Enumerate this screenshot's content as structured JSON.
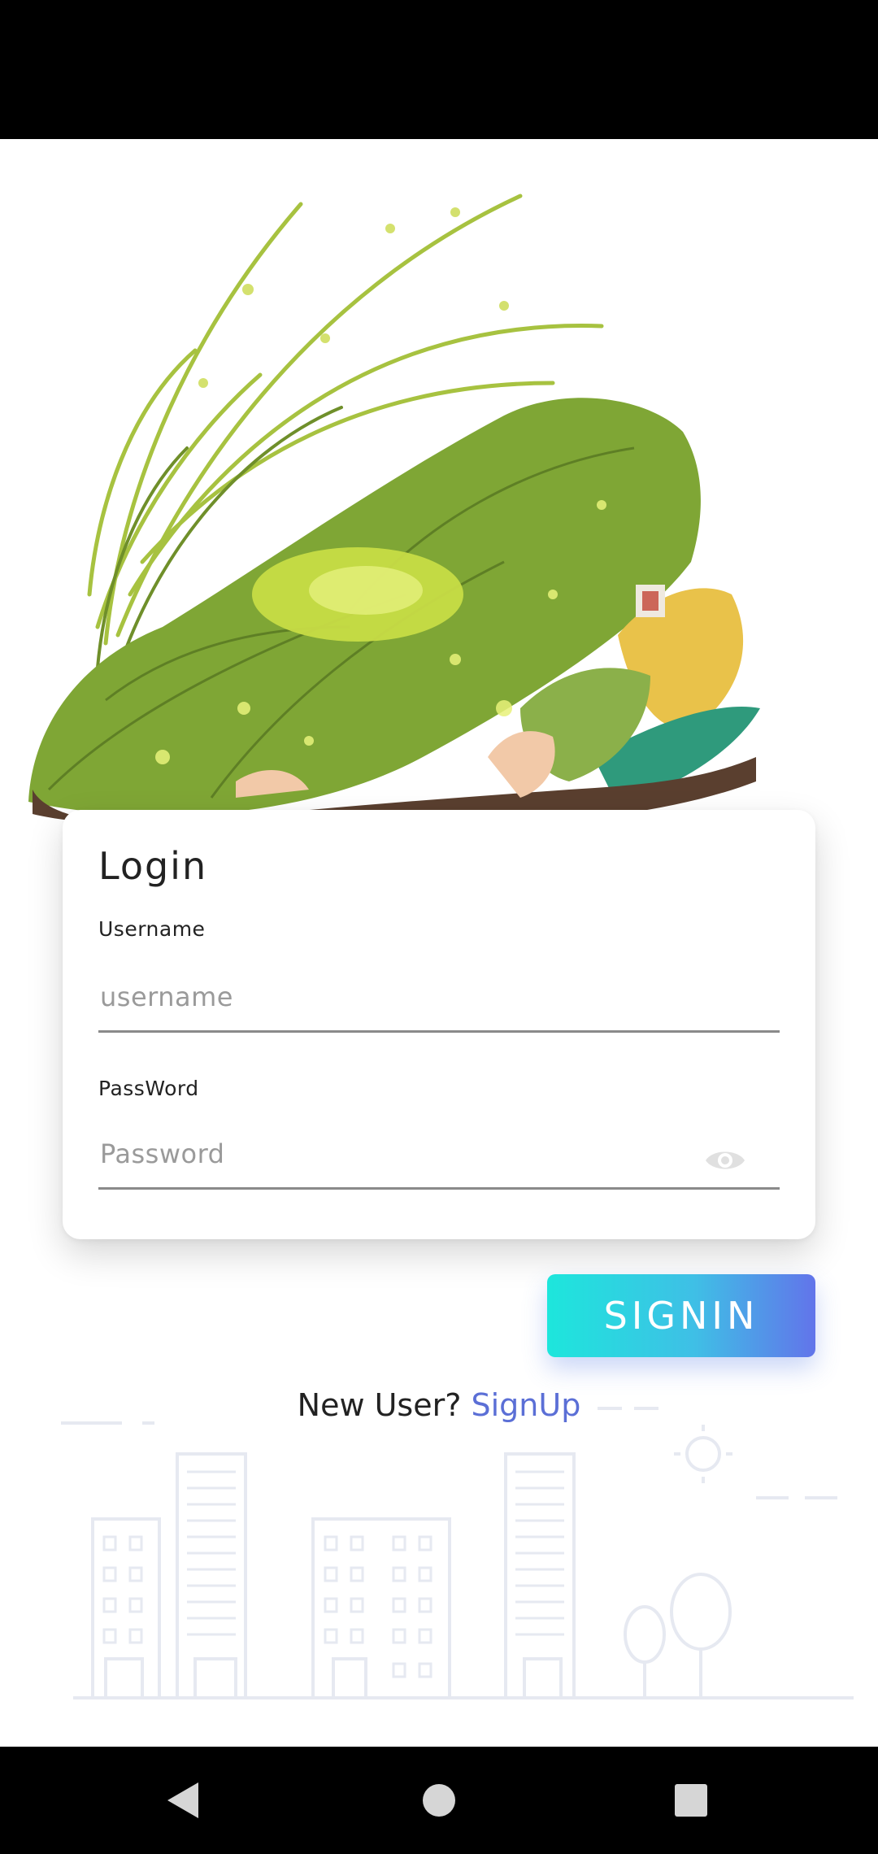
{
  "login": {
    "title": "Login",
    "username_label": "Username",
    "username_placeholder": "username",
    "username_value": "",
    "password_label": "PassWord",
    "password_placeholder": "Password",
    "password_value": ""
  },
  "actions": {
    "signin_label": "SIGNIN",
    "new_user_prompt": "New User?",
    "signup_label": "SignUp"
  },
  "icons": {
    "password_toggle": "eye-icon",
    "nav_back": "back-triangle-icon",
    "nav_home": "home-circle-icon",
    "nav_recent": "recent-apps-square-icon"
  },
  "colors": {
    "button_gradient_start": "#1de6dc",
    "button_gradient_end": "#6274ea",
    "link": "#5b6fd6",
    "system_bars": "#000000",
    "leaf_green": "#7fa635"
  }
}
